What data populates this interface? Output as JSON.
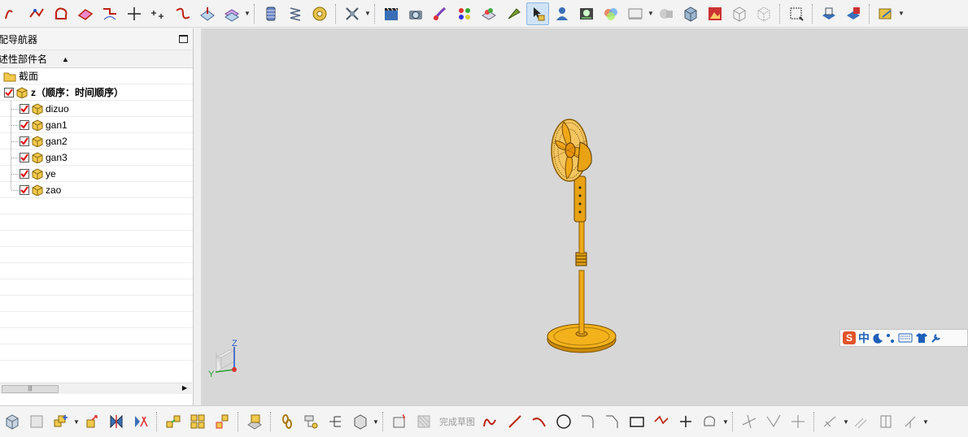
{
  "app": {
    "accent_active": "#cfe3f7",
    "viewport_bg": "#d7d7d7"
  },
  "top_toolbar": {
    "icons": [
      "arc-icon",
      "polyline-icon",
      "closed-curve-icon",
      "surface-icon",
      "curve-edit-icon",
      "cross-point-icon",
      "points-icon",
      "spline-icon",
      "plane-icon",
      "offset-surface-icon",
      "coil-icon",
      "spring-icon",
      "washer-icon",
      "weld-icon",
      "clapper-icon",
      "camera-icon",
      "paint-icon",
      "appearance-icon",
      "render-icon",
      "light-icon",
      "select-icon",
      "person-icon",
      "scene-icon",
      "spheres-icon",
      "display-icon",
      "shaded-box-icon",
      "solid-box-icon",
      "image-icon",
      "wireframe-icon",
      "hidden-line-icon",
      "fit-view-icon",
      "cad-icon",
      "cad-edit-icon",
      "export-icon"
    ]
  },
  "navigator": {
    "title": "配导航器",
    "column_header": "述性部件名",
    "tree": [
      {
        "label": "截面",
        "type": "folder",
        "checked": false,
        "bold": false
      },
      {
        "label": "z（顺序：时间顺序）",
        "type": "assembly",
        "checked": true,
        "bold": true
      },
      {
        "label": "dizuo",
        "type": "part",
        "checked": true,
        "bold": false
      },
      {
        "label": "gan1",
        "type": "part",
        "checked": true,
        "bold": false
      },
      {
        "label": "gan2",
        "type": "part",
        "checked": true,
        "bold": false
      },
      {
        "label": "gan3",
        "type": "part",
        "checked": true,
        "bold": false
      },
      {
        "label": "ye",
        "type": "part",
        "checked": true,
        "bold": false
      },
      {
        "label": "zao",
        "type": "part",
        "checked": true,
        "bold": false
      }
    ]
  },
  "viewport": {
    "axis_labels": {
      "z": "Z",
      "y": "Y"
    },
    "model": "standing-fan"
  },
  "ime": {
    "logo": "S",
    "mode": "中"
  },
  "bottom_toolbar": {
    "finish_sketch_label": "完成草图"
  }
}
